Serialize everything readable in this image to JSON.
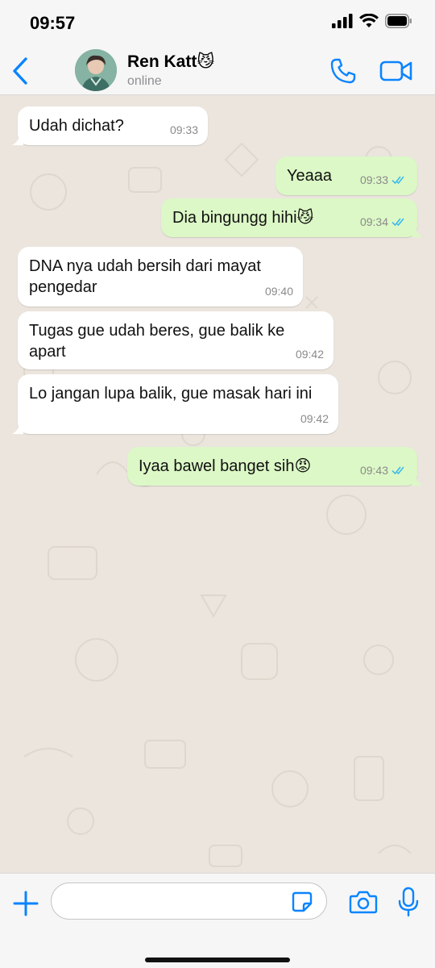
{
  "status_bar": {
    "time": "09:57"
  },
  "contact": {
    "name": "Ren Katt😼",
    "status": "online"
  },
  "messages": [
    {
      "direction": "in",
      "text": "Udah dichat?",
      "time": "09:33"
    },
    {
      "direction": "out",
      "text": "Yeaaa",
      "time": "09:33",
      "read": true
    },
    {
      "direction": "out",
      "text": "Dia bingungg hihi😼",
      "time": "09:34",
      "read": true
    },
    {
      "direction": "in",
      "text": "DNA nya udah bersih dari mayat pengedar",
      "time": "09:40"
    },
    {
      "direction": "in",
      "text": "Tugas gue udah beres, gue balik ke apart",
      "time": "09:42"
    },
    {
      "direction": "in",
      "text": "Lo jangan lupa balik, gue masak hari ini",
      "time": "09:42"
    },
    {
      "direction": "out",
      "text": "Iyaa bawel banget sih😡",
      "time": "09:43",
      "read": true
    }
  ],
  "input": {
    "placeholder": "",
    "value": ""
  },
  "colors": {
    "accent": "#0a84ff",
    "outgoing_bubble": "#dcf8c6",
    "incoming_bubble": "#ffffff",
    "chat_background": "#ebe5de",
    "read_ticks": "#34b7f1"
  },
  "icons": {
    "back": "chevron-left-icon",
    "call": "phone-icon",
    "video": "video-camera-icon",
    "plus": "plus-icon",
    "sticker": "sticker-icon",
    "camera": "camera-icon",
    "mic": "microphone-icon"
  }
}
